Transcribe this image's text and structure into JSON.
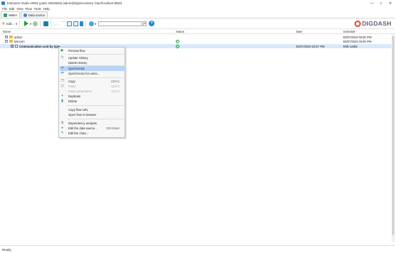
{
  "window": {
    "title": "Enterprise Studio 20081 (patch 20200626) (admin@tdgtomostosrp: http://localhost:8080)",
    "controls": [
      "—",
      "□",
      "✕"
    ]
  },
  "menubar": {
    "items": [
      "File",
      "Edit",
      "View",
      "Flow",
      "Tools",
      "Help"
    ]
  },
  "tabs": [
    {
      "label": "Wallet",
      "color": "#35a35f"
    },
    {
      "label": "Data source",
      "color": "#2f8ac7"
    }
  ],
  "toolbar": {
    "add_label": "Add...",
    "add_icon": "plus-icon",
    "search_placeholder": "",
    "help_label": "?"
  },
  "logo": {
    "text": "DIGDASH",
    "color": "#e2452f"
  },
  "columns": {
    "name": "Name",
    "status": "Status",
    "date": "Date",
    "schedule": "Schedule"
  },
  "rows": [
    {
      "label": "admin",
      "status": "",
      "date": "",
      "schedule": "05/07/2020 08:00 PM"
    },
    {
      "label": "telecom",
      "status": "ok",
      "date": "",
      "schedule": "05/07/2020 08:00 PM"
    },
    {
      "label": "Communication cost by type",
      "status": "ok",
      "date": "05/07/2020 03:27 PM",
      "schedule": "With wallet"
    }
  ],
  "context_menu": {
    "items": [
      {
        "label": "Preview flow",
        "shortcut": "",
        "icon": "play-icon",
        "glyph": "▶",
        "color": "#1e9c3a",
        "disabled": false,
        "highlight": false
      },
      {
        "label": "Update History",
        "shortcut": "",
        "icon": "refresh-icon",
        "glyph": "↻",
        "color": "#2f8ac7",
        "disabled": false,
        "highlight": false
      },
      {
        "label": "Delete History",
        "shortcut": "",
        "icon": "",
        "glyph": "",
        "color": "#666",
        "disabled": false,
        "highlight": false
      },
      {
        "label": "Synchronize",
        "shortcut": "",
        "icon": "sync-icon",
        "glyph": "⇄",
        "color": "#2f8ac7",
        "disabled": false,
        "highlight": true
      },
      {
        "label": "Synchronize for users...",
        "shortcut": "",
        "icon": "sync-users-icon",
        "glyph": "⇄",
        "color": "#2f8ac7",
        "disabled": false,
        "highlight": false
      },
      {
        "label": "Copy",
        "shortcut": "Ctrl+C",
        "icon": "copy-icon",
        "glyph": "❐",
        "color": "#2f8ac7",
        "disabled": false,
        "highlight": false
      },
      {
        "label": "Paste",
        "shortcut": "Ctrl+V",
        "icon": "paste-icon",
        "glyph": "▤",
        "color": "#aaa",
        "disabled": true,
        "highlight": false
      },
      {
        "label": "Paste parameters",
        "shortcut": "Ctrl+K",
        "icon": "",
        "glyph": "",
        "color": "#aaa",
        "disabled": true,
        "highlight": false
      },
      {
        "label": "Duplicate",
        "shortcut": "",
        "icon": "duplicate-icon",
        "glyph": "+",
        "color": "#1e9c3a",
        "disabled": false,
        "highlight": false
      },
      {
        "label": "Delete",
        "shortcut": "",
        "icon": "trash-icon",
        "glyph": "🗑",
        "color": "#2f8ac7",
        "disabled": false,
        "highlight": false
      },
      {
        "label": "Copy flow URL",
        "shortcut": "",
        "icon": "",
        "glyph": "",
        "color": "#666",
        "disabled": false,
        "highlight": false
      },
      {
        "label": "Open flow in browser",
        "shortcut": "",
        "icon": "",
        "glyph": "",
        "color": "#666",
        "disabled": false,
        "highlight": false
      },
      {
        "label": "Dependency analysis",
        "shortcut": "",
        "icon": "dependency-icon",
        "glyph": "⚙",
        "color": "#2f8ac7",
        "disabled": false,
        "highlight": false
      },
      {
        "label": "Edit the data source...",
        "shortcut": "Ctrl+Enter",
        "icon": "datasource-icon",
        "glyph": "●",
        "color": "#1e9c3a",
        "disabled": false,
        "highlight": false
      },
      {
        "label": "Edit the chart...",
        "shortcut": "",
        "icon": "chart-icon",
        "glyph": "✎",
        "color": "#2f8ac7",
        "disabled": false,
        "highlight": false
      }
    ]
  },
  "status": {
    "text": "Ready"
  }
}
